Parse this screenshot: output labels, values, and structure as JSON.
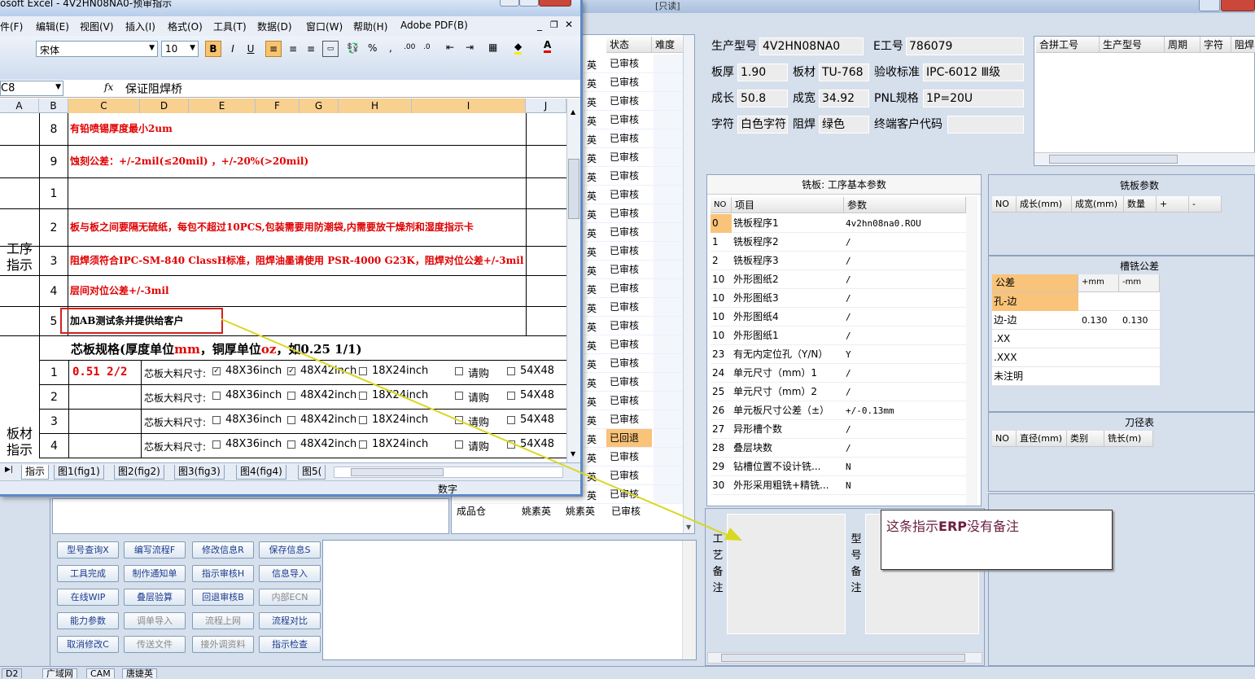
{
  "erp": {
    "window_title": "[只读]",
    "middle_header": {
      "status": "状态",
      "difficulty": "难度"
    },
    "middle_rows": [
      {
        "n": "英",
        "s": "已审核"
      },
      {
        "n": "英",
        "s": "已审核"
      },
      {
        "n": "英",
        "s": "已审核"
      },
      {
        "n": "英",
        "s": "已审核"
      },
      {
        "n": "英",
        "s": "已审核"
      },
      {
        "n": "英",
        "s": "已审核"
      },
      {
        "n": "英",
        "s": "已审核"
      },
      {
        "n": "英",
        "s": "已审核"
      },
      {
        "n": "英",
        "s": "已审核"
      },
      {
        "n": "英",
        "s": "已审核"
      },
      {
        "n": "英",
        "s": "已审核"
      },
      {
        "n": "英",
        "s": "已审核"
      },
      {
        "n": "英",
        "s": "已审核"
      },
      {
        "n": "英",
        "s": "已审核"
      },
      {
        "n": "英",
        "s": "已审核"
      },
      {
        "n": "英",
        "s": "已审核"
      },
      {
        "n": "英",
        "s": "已审核"
      },
      {
        "n": "英",
        "s": "已审核"
      },
      {
        "n": "英",
        "s": "已审核"
      },
      {
        "n": "英",
        "s": "已审核"
      },
      {
        "n": "英",
        "s": "已回退"
      },
      {
        "n": "英",
        "s": "已审核"
      },
      {
        "n": "英",
        "s": "已审核"
      },
      {
        "n": "英",
        "s": "已审核"
      }
    ],
    "last_row": {
      "a": "成品仓",
      "b": "姚素英",
      "c": "姚素英",
      "d": "已审核"
    },
    "info": {
      "prod_model_label": "生产型号",
      "prod_model": "4V2HN08NA0",
      "e_no_label": "E工号",
      "e_no": "786079",
      "thickness_label": "板厚",
      "thickness": "1.90",
      "material_label": "板材",
      "material": "TU-768",
      "accept_label": "验收标准",
      "accept": "IPC-6012 Ⅲ级",
      "length_label": "成长",
      "length": "50.8",
      "width_label": "成宽",
      "width": "34.92",
      "pnl_label": "PNL规格",
      "pnl": "1P=20U",
      "char_label": "字符",
      "char": "白色字符",
      "mask_label": "阻焊",
      "mask": "绿色",
      "endcust_label": "终端客户代码",
      "endcust": ""
    },
    "merge_headers": [
      "合拼工号",
      "生产型号",
      "周期",
      "字符",
      "阻焊"
    ],
    "mill": {
      "title": "铣板: 工序基本参数",
      "col_no": "NO",
      "col_item": "项目",
      "col_param": "参数",
      "rows": [
        {
          "no": "0",
          "item": "铣板程序1",
          "param": "4v2hn08na0.ROU"
        },
        {
          "no": "1",
          "item": "铣板程序2",
          "param": "/"
        },
        {
          "no": "2",
          "item": "铣板程序3",
          "param": "/"
        },
        {
          "no": "10",
          "item": "外形图纸2",
          "param": "/"
        },
        {
          "no": "10",
          "item": "外形图纸3",
          "param": "/"
        },
        {
          "no": "10",
          "item": "外形图纸4",
          "param": "/"
        },
        {
          "no": "10",
          "item": "外形图纸1",
          "param": "/"
        },
        {
          "no": "23",
          "item": "有无内定位孔（Y/N）",
          "param": "Y"
        },
        {
          "no": "24",
          "item": "单元尺寸（mm）1",
          "param": "/"
        },
        {
          "no": "25",
          "item": "单元尺寸（mm）2",
          "param": "/"
        },
        {
          "no": "26",
          "item": "单元板尺寸公差（±）",
          "param": "+/-0.13mm"
        },
        {
          "no": "27",
          "item": "异形槽个数",
          "param": "/"
        },
        {
          "no": "28",
          "item": "叠层块数",
          "param": "/"
        },
        {
          "no": "29",
          "item": "钻槽位置不设计铣...",
          "param": "N"
        },
        {
          "no": "30",
          "item": "外形采用粗铣+精铣...",
          "param": "N"
        }
      ]
    },
    "millparams": {
      "title": "铣板参数",
      "cols": [
        "NO",
        "成长(mm)",
        "成宽(mm)",
        "数量",
        "+",
        "-"
      ]
    },
    "slot": {
      "title": "槽铣公差",
      "cols": [
        "公差",
        "+mm",
        "-mm"
      ],
      "rows": [
        {
          "a": "孔-边",
          "b": "",
          "c": ""
        },
        {
          "a": "边-边",
          "b": "0.130",
          "c": "0.130"
        },
        {
          "a": ".XX",
          "b": "",
          "c": ""
        },
        {
          "a": ".XXX",
          "b": "",
          "c": ""
        },
        {
          "a": "未注明",
          "b": "",
          "c": ""
        }
      ]
    },
    "tool": {
      "title": "刀径表",
      "cols": [
        "NO",
        "直径(mm)",
        "类别",
        "铣长(m)"
      ]
    },
    "process_note": "工艺备注",
    "model_note": "型号备注",
    "callout": {
      "prefix": "这条指示",
      "bold": "ERP",
      "suffix": "没有备注"
    },
    "buttons": [
      [
        "型号查询X",
        "编写流程F",
        "修改信息R",
        "保存信息S"
      ],
      [
        "工具完成",
        "制作通知单",
        "指示审核H",
        "信息导入"
      ],
      [
        "在线WIP",
        "叠层验算",
        "回退审核B",
        "内部ECN"
      ],
      [
        "能力参数",
        "调单导入",
        "流程上网",
        "流程对比"
      ],
      [
        "取消修改C",
        "传送文件",
        "接外调资料",
        "指示检查"
      ]
    ],
    "taskbar": [
      "D2",
      "广域网",
      "CAM",
      "唐婕英"
    ]
  },
  "excel": {
    "title": "osoft Excel - 4V2HN08NA0-预审指示",
    "menus": [
      "件(F)",
      "编辑(E)",
      "视图(V)",
      "插入(I)",
      "格式(O)",
      "工具(T)",
      "数据(D)",
      "窗口(W)",
      "帮助(H)",
      "Adobe PDF(B)"
    ],
    "font": "宋体",
    "size": "10",
    "namebox": "C8",
    "fx": "fx",
    "formula": "保证阻焊桥",
    "cols": [
      "A",
      "B",
      "C",
      "D",
      "E",
      "F",
      "G",
      "H",
      "I",
      "J"
    ],
    "rows": [
      {
        "n": "8",
        "t": "有铅喷锡厚度最小2um"
      },
      {
        "n": "9",
        "t": "蚀刻公差：+/-2mil(≤20mil) ，+/-20%(>20mil)"
      },
      {
        "n": "1",
        "t": ""
      },
      {
        "n": "2",
        "t": "板与板之间要隔无硫纸，每包不超过10PCS,包装需要用防潮袋,内需要放干燥剂和湿度指示卡"
      },
      {
        "n": "3",
        "t": "阻焊须符合IPC-SM-840 ClassH标准，阻焊油墨请使用 PSR-4000 G23K，阻焊对位公差+/-3mil"
      },
      {
        "n": "4",
        "t": "层间对位公差+/-3mil"
      },
      {
        "n": "5",
        "t": "加AB测试条并提供给客户"
      }
    ],
    "section_a": "工序指示",
    "section_b": "板材指示",
    "core_heading": "芯板规格(厚度单位mm，铜厚单位oz，如0.25 1/1)",
    "core_heading_plain1": "芯板规格(厚度单位",
    "core_mm": "mm",
    "core_heading_plain2": "，铜厚单位",
    "core_oz": "oz",
    "core_heading_plain3": "，如0.25 1/1)",
    "core_rows": [
      {
        "n": "1",
        "spec": "0.51 2/2",
        "label": "芯板大料尺寸:",
        "o1": "48X36inch",
        "o2": "48X42inch",
        "o3": "18X24inch",
        "o4": "请购",
        "o5": "54X48",
        "c1": true,
        "c2": true
      },
      {
        "n": "2",
        "spec": "",
        "label": "芯板大料尺寸:",
        "o1": "48X36inch",
        "o2": "48X42inch",
        "o3": "18X24inch",
        "o4": "请购",
        "o5": "54X48",
        "c1": false,
        "c2": false
      },
      {
        "n": "3",
        "spec": "",
        "label": "芯板大料尺寸:",
        "o1": "48X36inch",
        "o2": "48X42inch",
        "o3": "18X24inch",
        "o4": "请购",
        "o5": "54X48",
        "c1": false,
        "c2": false
      },
      {
        "n": "4",
        "spec": "",
        "label": "芯板大料尺寸:",
        "o1": "48X36inch",
        "o2": "48X42inch",
        "o3": "18X24inch",
        "o4": "请购",
        "o5": "54X48",
        "c1": false,
        "c2": false
      }
    ],
    "sheets": [
      "指示",
      "图1(fig1)",
      "图2(fig2)",
      "图3(fig3)",
      "图4(fig4)",
      "图5("
    ],
    "status": "数字"
  },
  "colors": {
    "red": "#e00000",
    "highlight": "#f9c37a",
    "callout_border": "#d32121",
    "arrow": "#e8e82a"
  }
}
